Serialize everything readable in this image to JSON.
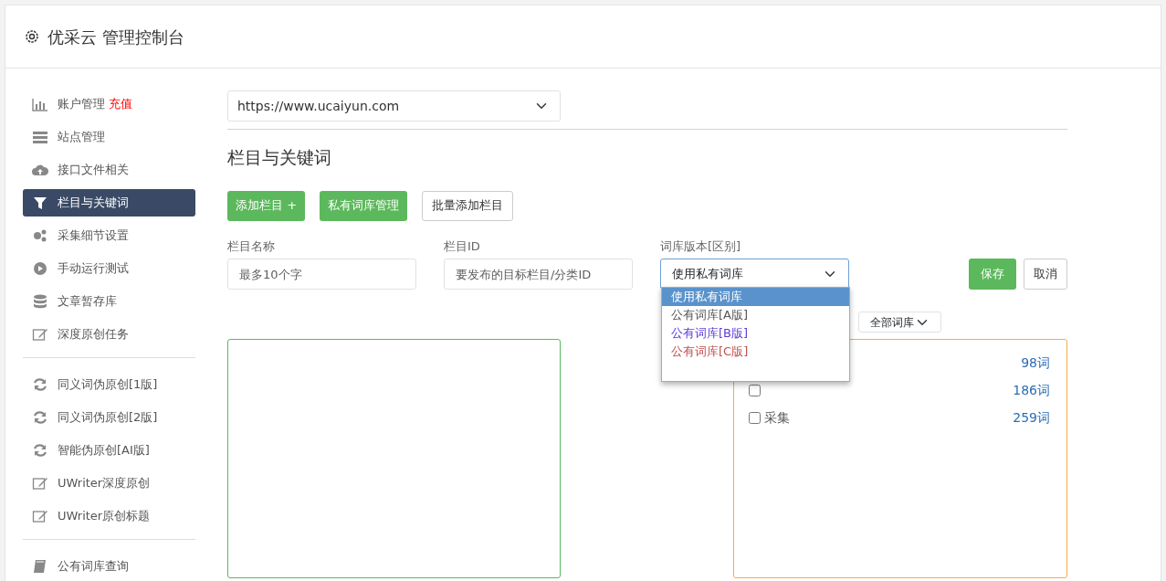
{
  "header": {
    "title": "优采云 管理控制台"
  },
  "sidebar": {
    "groups": [
      [
        {
          "label": "账户管理",
          "badge": "充值",
          "selected": false
        },
        {
          "label": "站点管理",
          "selected": false
        },
        {
          "label": "接口文件相关",
          "selected": false
        },
        {
          "label": "栏目与关键词",
          "selected": true
        },
        {
          "label": "采集细节设置",
          "selected": false
        },
        {
          "label": "手动运行测试",
          "selected": false
        },
        {
          "label": "文章暂存库",
          "selected": false
        },
        {
          "label": "深度原创任务",
          "selected": false
        }
      ],
      [
        {
          "label": "同义词伪原创[1版]",
          "selected": false
        },
        {
          "label": "同义词伪原创[2版]",
          "selected": false
        },
        {
          "label": "智能伪原创[AI版]",
          "selected": false
        },
        {
          "label": "UWriter深度原创",
          "selected": false
        },
        {
          "label": "UWriter原创标题",
          "selected": false
        }
      ],
      [
        {
          "label": "公有词库查询",
          "selected": false
        }
      ]
    ]
  },
  "site_select": {
    "value": "https://www.ucaiyun.com"
  },
  "section_title": "栏目与关键词",
  "buttons": [
    {
      "label": "添加栏目 +",
      "kind": "success"
    },
    {
      "label": "私有词库管理",
      "kind": "success"
    },
    {
      "label": "批量添加栏目",
      "kind": "outline"
    }
  ],
  "form": {
    "fields": [
      {
        "label": "栏目名称",
        "placeholder": "最多10个字",
        "kind": "input"
      },
      {
        "label": "栏目ID",
        "placeholder": "要发布的目标栏目/分类ID",
        "kind": "input"
      },
      {
        "label": "词库版本[区别]",
        "value": "使用私有词库",
        "kind": "select"
      }
    ],
    "save": "保存",
    "cancel": "取消",
    "dropdown": [
      {
        "label": "使用私有词库",
        "selected": true
      },
      {
        "label": "公有词库[A版]",
        "selected": false,
        "color": "#555555"
      },
      {
        "label": "公有词库[B版]",
        "selected": false,
        "color": "#5b3bd6"
      },
      {
        "label": "公有词库[C版]",
        "selected": false,
        "color": "#c0504d"
      }
    ]
  },
  "library_filter": {
    "value": "全部词库"
  },
  "library_rows": [
    {
      "count": "98词"
    },
    {
      "checked": false,
      "count": "186词"
    },
    {
      "label": "采集",
      "checked": false,
      "count": "259词"
    }
  ]
}
